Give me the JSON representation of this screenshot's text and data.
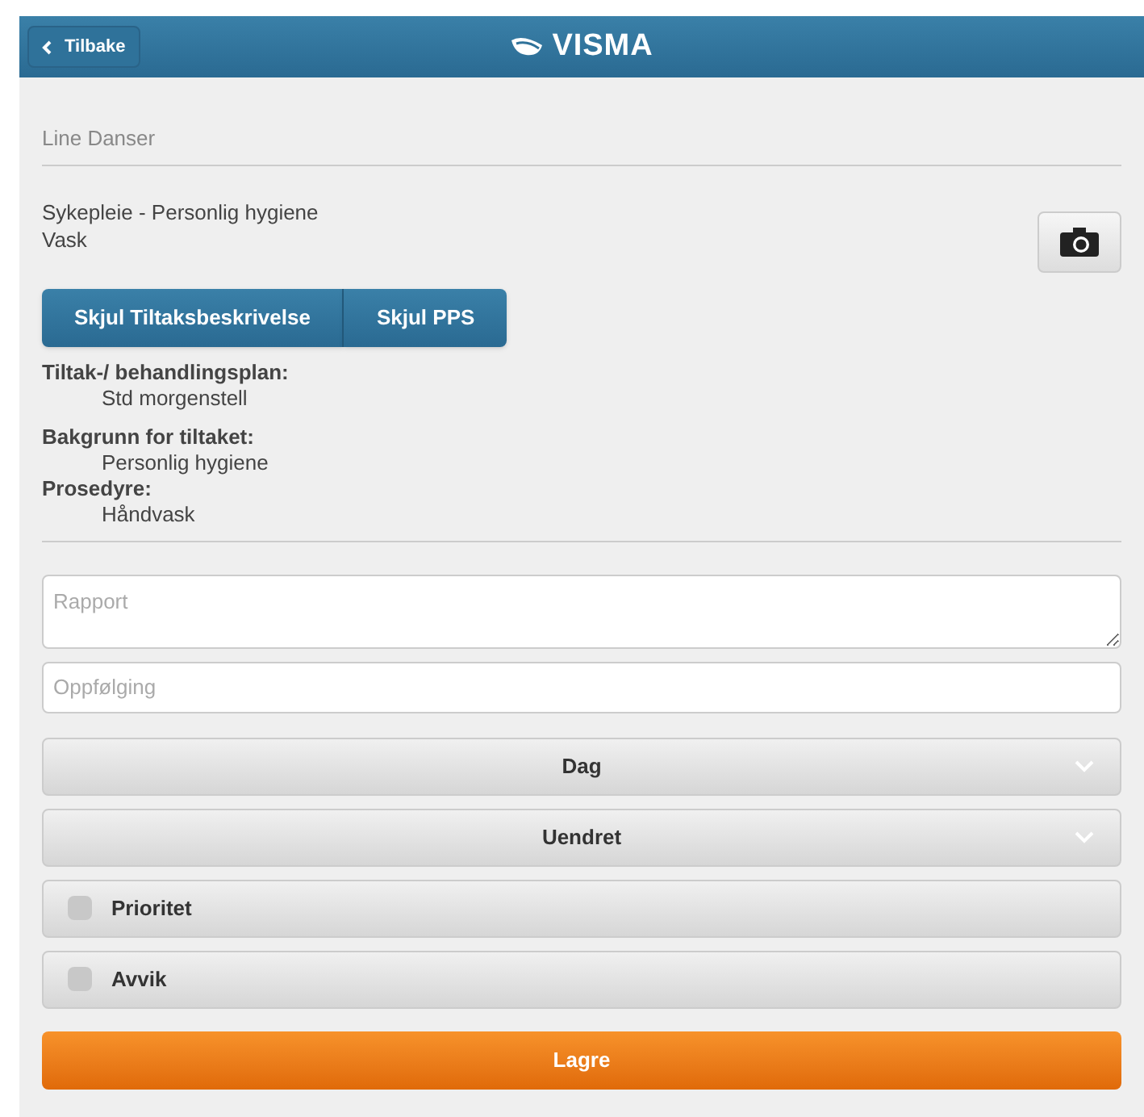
{
  "header": {
    "back_button": "Tilbake",
    "logo": "VISMA"
  },
  "patient_name": "Line Danser",
  "task": {
    "category": "Sykepleie - Personlig hygiene",
    "name": "Vask"
  },
  "toggle_buttons": [
    "Skjul Tiltaksbeskrivelse",
    "Skjul PPS"
  ],
  "details": [
    {
      "label": "Tiltak-/ behandlingsplan:",
      "value": "Std morgenstell"
    },
    {
      "label": "Bakgrunn for tiltaket:",
      "value": "Personlig hygiene"
    },
    {
      "label": "Prosedyre:",
      "value": "Håndvask"
    }
  ],
  "report_field": {
    "placeholder": "Rapport"
  },
  "followup_field": {
    "placeholder": "Oppfølging"
  },
  "selects": [
    {
      "value": "Dag"
    },
    {
      "value": "Uendret"
    }
  ],
  "checkboxes": [
    {
      "label": "Prioritet",
      "checked": false
    },
    {
      "label": "Avvik",
      "checked": false
    }
  ],
  "save_button": "Lagre"
}
